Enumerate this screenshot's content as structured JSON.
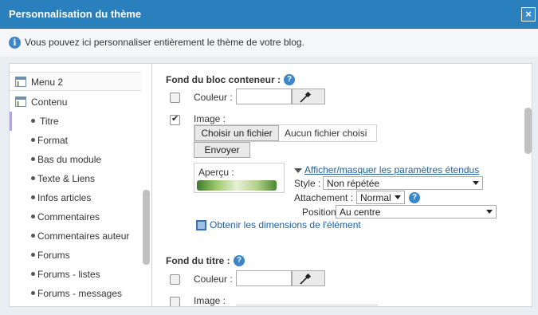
{
  "dialog": {
    "title": "Personnalisation du thème",
    "close_label": "×",
    "info_text": "Vous pouvez ici personnaliser entièrement le thème de votre blog."
  },
  "sidebar": {
    "items": [
      {
        "label": "Menu 2"
      },
      {
        "label": "Contenu"
      },
      {
        "label": "Titre"
      },
      {
        "label": "Format"
      },
      {
        "label": "Bas du module"
      },
      {
        "label": "Texte & Liens"
      },
      {
        "label": "Infos articles"
      },
      {
        "label": "Commentaires"
      },
      {
        "label": "Commentaires auteur"
      },
      {
        "label": "Forums"
      },
      {
        "label": "Forums - listes"
      },
      {
        "label": "Forums - messages"
      }
    ]
  },
  "bloc_conteneur": {
    "title": "Fond du bloc conteneur :",
    "couleur_label": "Couleur :",
    "couleur_value": "",
    "couleur_checked": false,
    "image_label": "Image :",
    "image_checked": true,
    "choose_file_label": "Choisir un fichier",
    "no_file_label": "Aucun fichier choisi",
    "send_label": "Envoyer",
    "preview_label": "Aperçu :",
    "toggle_link": "Afficher/masquer les paramètres étendus",
    "style_label": "Style :",
    "style_value": "Non répétée",
    "attachement_label": "Attachement :",
    "attachement_value": "Normal",
    "position_label": "Position :",
    "position_value": "Au centre",
    "dimensions_link": "Obtenir les dimensions de l'élément"
  },
  "fond_titre": {
    "title": "Fond du titre :",
    "couleur_label": "Couleur :",
    "couleur_value": "",
    "couleur_checked": false,
    "image_label": "Image :",
    "image_checked": false
  },
  "colors": {
    "titlebar": "#2a7fbd",
    "link": "#1f5f99",
    "help": "#3a86c9"
  }
}
